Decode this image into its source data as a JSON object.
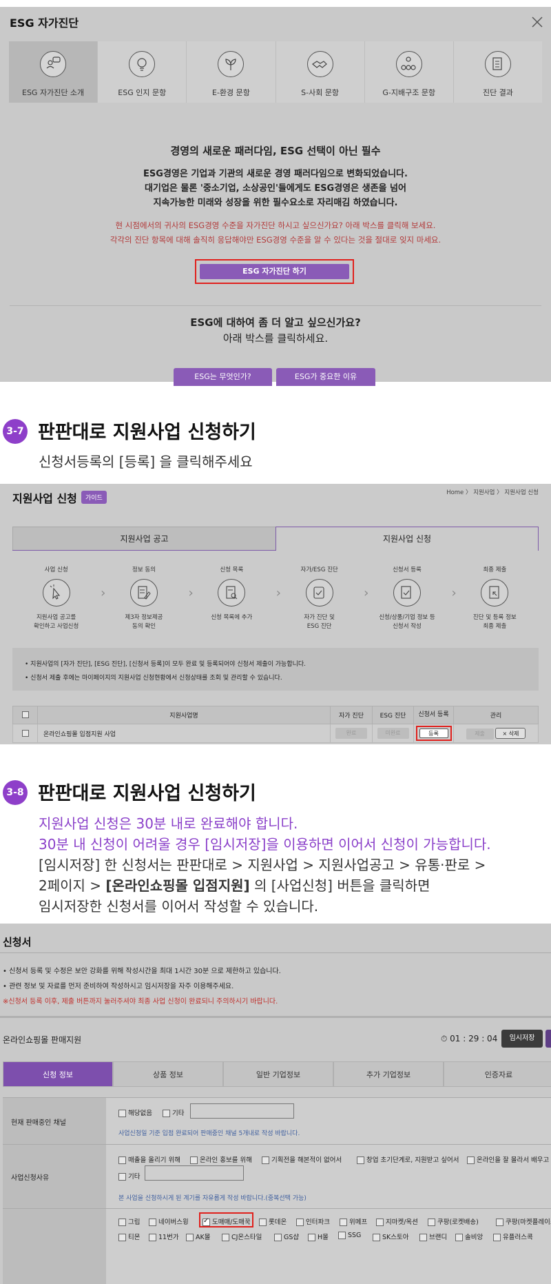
{
  "esg": {
    "title": "ESG 자가진단",
    "tabs": [
      {
        "label": "ESG 자가진단 소개",
        "icon": "chat-people-icon"
      },
      {
        "label": "ESG 인지 문항",
        "icon": "lightbulb-icon"
      },
      {
        "label": "E-환경 문항",
        "icon": "leaf-icon"
      },
      {
        "label": "S-사회 문항",
        "icon": "handshake-icon"
      },
      {
        "label": "G-지배구조 문항",
        "icon": "organization-icon"
      },
      {
        "label": "진단 결과",
        "icon": "clipboard-icon"
      }
    ],
    "headline": "경영의 새로운 패러다임, ESG 선택이 아닌 필수",
    "para1": "ESG경영은 기업과 기관의 새로운 경영 패러다임으로 변화되었습니다.",
    "para2": "대기업은 물론 '중소기업, 소상공인'들에게도 ESG경영은 생존을 넘어",
    "para3": "지속가능한 미래와 성장을 위한 필수요소로 자리매김 하였습니다.",
    "red1": "현 시점에서의 귀사의 ESG경영 수준을 자가진단 하시고 싶으신가요? 아래 박스를 클릭해 보세요.",
    "red2": "각각의 진단 항목에 대해 솔직히 응답해야만 ESG경영 수준을 알 수 있다는 것을 절대로 잊지 마세요.",
    "start_button": "ESG 자가진단 하기",
    "more_line1": "ESG에 대하여 좀 더 알고 싶으신가요?",
    "more_line2": "아래 박스를 클릭하세요.",
    "what_button": "ESG는 무엇인가?",
    "why_button": "ESG가 중요한 이유"
  },
  "step37": {
    "num": "3-7",
    "title": "판판대로 지원사업 신청하기",
    "sub": "신청서등록의 [등록] 을 클릭해주세요"
  },
  "apply": {
    "title": "지원사업 신청",
    "guide": "가이드",
    "breadcrumb": "Home 〉 지원사업 〉 지원사업 신청",
    "tab_notice": "지원사업 공고",
    "tab_apply": "지원사업 신청",
    "steps": [
      {
        "title": "사업 신청",
        "desc1": "지원사업 공고를",
        "desc2": "확인하고 사업신청",
        "icon": "click-icon"
      },
      {
        "title": "정보 동의",
        "desc1": "제3자 정보제공",
        "desc2": "동의 확인",
        "icon": "document-edit-icon"
      },
      {
        "title": "신청 목록",
        "desc1": "신청 목록에 추가",
        "desc2": "",
        "icon": "document-search-icon"
      },
      {
        "title": "자가/ESG 진단",
        "desc1": "자가 진단 및",
        "desc2": "ESG 진단",
        "icon": "checkbox-icon"
      },
      {
        "title": "신청서 등록",
        "desc1": "신청/상품/기업 정보 등",
        "desc2": "신청서 작성",
        "icon": "form-check-icon"
      },
      {
        "title": "최종 제출",
        "desc1": "진단 및 등록 정보",
        "desc2": "최종 제출",
        "icon": "submit-icon"
      }
    ],
    "note1": "• 지원사업의 [자가 진단], [ESG 진단], [신청서 등록]이 모두 완료 및 등록되어야 신청서 제출이 가능합니다.",
    "note2": "• 신청서 제출 후에는 마이페이지의 지원사업 신청현황에서 신청상태를 조회 및 관리할 수 있습니다.",
    "table": {
      "headers": [
        "지원사업명",
        "자가 진단",
        "ESG 진단",
        "신청서 등록",
        "관리"
      ],
      "row": {
        "name": "온라인쇼핑몰 입점지원 사업",
        "self": "완료",
        "esg": "미완료",
        "reg": "등록",
        "edit": "제출",
        "del": "× 삭제"
      }
    }
  },
  "step38": {
    "num": "3-8",
    "title": "판판대로 지원사업 신청하기",
    "line1": "지원사업 신청은 30분 내로 완료해야 합니다.",
    "line2": "30분 내 신청이 어려울 경우 [임시저장]을 이용하면 이어서 신청이 가능합니다.",
    "line3": "[임시저장] 한 신청서는 판판대로 > 지원사업 > 지원사업공고 > 유통·판로 >",
    "line4a": "2페이지 > ",
    "line4b": "[온라인쇼핑몰 입점지원]",
    "line4c": " 의 [사업신청] 버튼을 클릭하면",
    "line5": "임시저장한 신청서를 이어서 작성할 수 있습니다."
  },
  "form": {
    "title": "신청서",
    "note1": "• 신청서 등록 및 수정은 보안 강화를 위해 작성시간을 최대 1시간 30분 으로 제한하고 있습니다.",
    "note2": "• 관련 정보 및 자료를 먼저 준비하여 작성하시고 임시저장을 자주 이용해주세요.",
    "note3": "※신청서 등록 이후, 제출 버튼까지 눌러주셔야 최종 사업 신청이 완료되니 주의하시기 바랍니다.",
    "business": "온라인쇼핑몰 판매지원",
    "timer": "⏱ 01 : 29 : 04",
    "temp_save": "임시저장",
    "tabs": [
      "신청 정보",
      "상품 정보",
      "일반 기업정보",
      "추가 기업정보",
      "인증자료"
    ],
    "row1_label": "현재 판매중인 채널",
    "row1_opts": [
      "해당없음",
      "기타"
    ],
    "row1_hint": "사업신청일 기준 입점 완료되어 판매중인 채널 5개내로 작성 바랍니다.",
    "row2_label": "사업신청사유",
    "row2_opts": [
      "매출을 올리기 위해",
      "온라인 홍보를 위해",
      "기획전을 해본적이 없어서",
      "창업 초기단계로, 지원받고 싶어서",
      "온라인을 잘 몰라서 배우고"
    ],
    "row2_other": "기타",
    "row2_hint": "본 사업을 신청하시게 된 계기를 자유롭게 작성 바랍니다.(중복선택 가능)",
    "row3_opts_a": [
      "그립",
      "네이버스윙",
      "도매매/도매꾹",
      "롯데온",
      "인터파크",
      "위메프",
      "지마켓/옥션",
      "쿠팡(로켓배송)",
      "쿠팡(마켓플레이스"
    ],
    "row3_opts_b": [
      "티몬",
      "11번가",
      "AK몰",
      "CJ온스타일",
      "GS샵",
      "H몰",
      "SSG",
      "SK스토아",
      "브랜디",
      "솔비앙",
      "유플러스콕"
    ]
  }
}
